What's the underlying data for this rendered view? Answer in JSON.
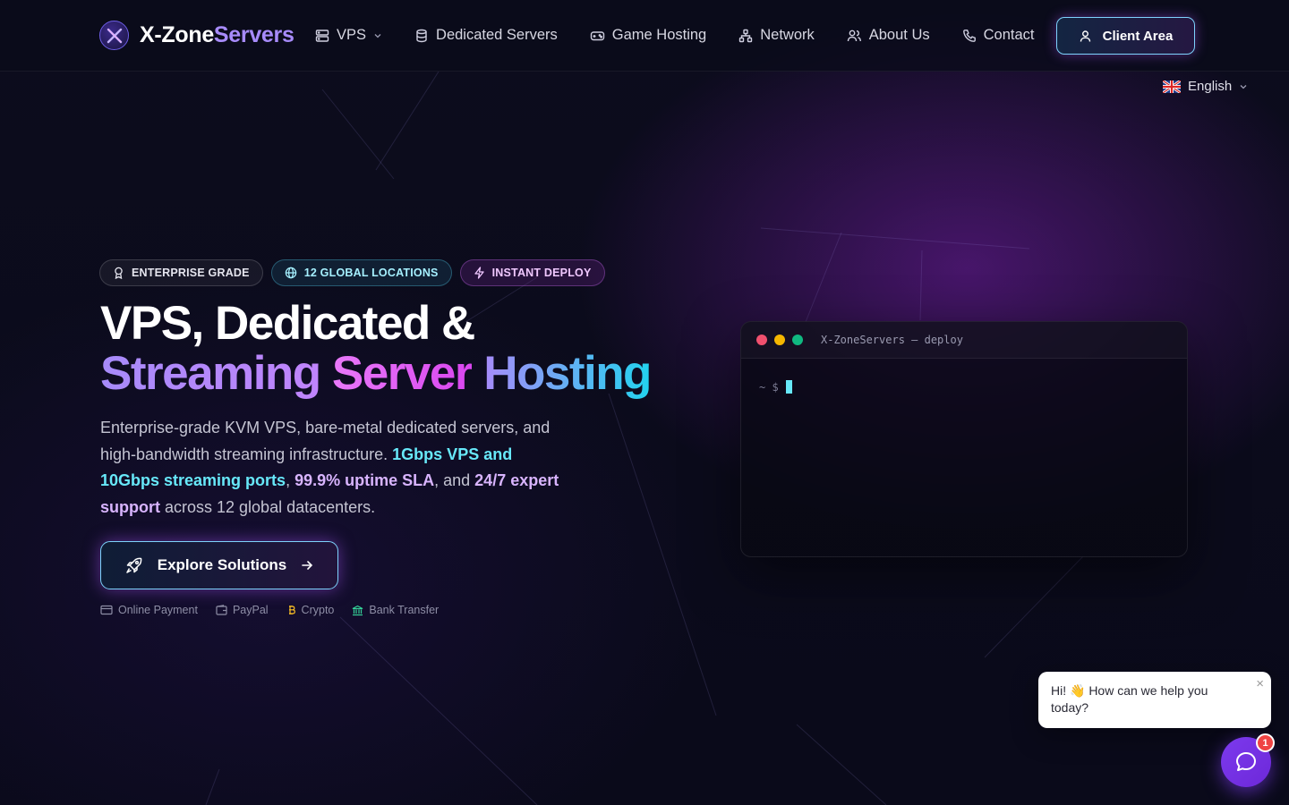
{
  "colors": {
    "accent_violet": "#a78bfa",
    "accent_cyan": "#67e8f9",
    "accent_pink": "#e879f9",
    "background": "#0b0b1b",
    "chat_purple": "#7c3aed"
  },
  "header": {
    "logo": {
      "text_part1": "X-Zone",
      "text_part2": "Servers",
      "icon": "x-logo-icon"
    },
    "nav": [
      {
        "label": "VPS",
        "icon": "server-stack-icon",
        "has_dropdown": true
      },
      {
        "label": "Dedicated Servers",
        "icon": "database-icon"
      },
      {
        "label": "Game Hosting",
        "icon": "gamepad-icon"
      },
      {
        "label": "Network",
        "icon": "network-icon"
      },
      {
        "label": "About Us",
        "icon": "users-icon"
      },
      {
        "label": "Contact",
        "icon": "phone-icon"
      }
    ],
    "client_area": {
      "label": "Client Area",
      "icon": "user-icon"
    },
    "language": {
      "label": "English",
      "flag": "uk-flag-icon"
    }
  },
  "hero": {
    "badges": [
      {
        "label": "ENTERPRISE GRADE",
        "icon": "award-icon"
      },
      {
        "label": "12 GLOBAL LOCATIONS",
        "icon": "globe-icon"
      },
      {
        "label": "INSTANT DEPLOY",
        "icon": "bolt-icon"
      }
    ],
    "title_line1": "VPS, Dedicated &",
    "title_line2_word1": "Streaming",
    "title_line2_word2": "Server",
    "title_line2_word3": "Hosting",
    "description": {
      "part1": "Enterprise-grade KVM VPS, bare-metal dedicated servers, and high-bandwidth streaming infrastructure. ",
      "highlight1": "1Gbps VPS and 10Gbps streaming ports",
      "part2": ", ",
      "highlight2": "99.9% uptime SLA",
      "part3": ", and ",
      "highlight3": "24/7 expert support",
      "part4": " across 12 global datacenters."
    },
    "cta": {
      "label": "Explore Solutions",
      "icon": "rocket-icon",
      "trailing_icon": "arrow-right-icon"
    },
    "payments": [
      {
        "label": "Online Payment",
        "icon": "credit-card-icon"
      },
      {
        "label": "PayPal",
        "icon": "wallet-icon"
      },
      {
        "label": "Crypto",
        "icon": "bitcoin-icon"
      },
      {
        "label": "Bank Transfer",
        "icon": "bank-icon"
      }
    ]
  },
  "terminal": {
    "title": "X-ZoneServers — deploy",
    "prompt": "~ $"
  },
  "chat": {
    "message": "Hi! 👋 How can we help you today?",
    "close": "×",
    "badge_count": "1"
  }
}
